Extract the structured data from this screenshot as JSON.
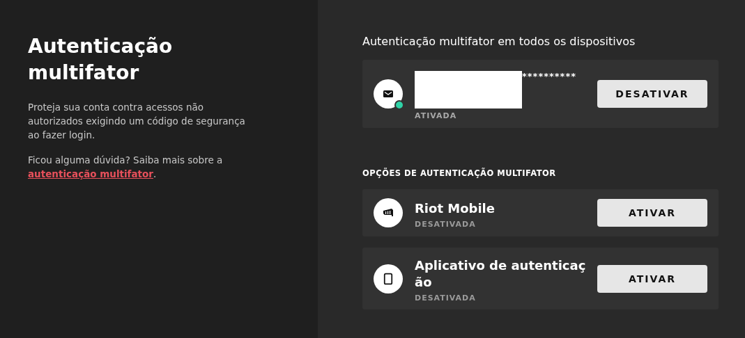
{
  "intro": {
    "title": "Autenticação multifator",
    "description": "Proteja sua conta contra acessos não autorizados exigindo um código de segurança ao fazer login.",
    "help_text": "Ficou alguma dúvida? Saiba mais sobre a",
    "help_link": "autenticação multifator",
    "help_end": "."
  },
  "active_heading": "Autenticação multifator em todos os dispositivos",
  "active_methods": [
    {
      "kind": "email",
      "redacted": true,
      "name": "**********",
      "status": "ATIVADA",
      "active": true,
      "button": "DESATIVAR"
    }
  ],
  "options_heading": "OPÇÕES DE AUTENTICAÇÃO MULTIFATOR",
  "options": [
    {
      "kind": "riot_mobile",
      "name": "Riot Mobile",
      "status": "DESATIVADA",
      "active": false,
      "button": "ATIVAR"
    },
    {
      "kind": "authenticator",
      "name": "Aplicativo de autenticação",
      "status": "DESATIVADA",
      "active": false,
      "button": "ATIVAR"
    }
  ]
}
